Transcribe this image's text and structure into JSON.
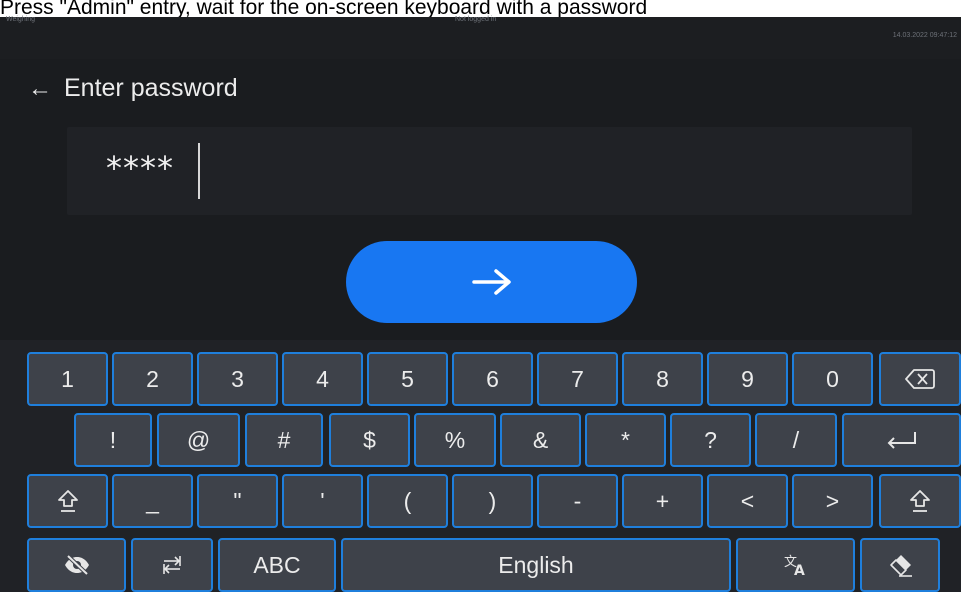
{
  "doc_caption": "Press \"Admin\" entry, wait for the on-screen keyboard with a password",
  "status": {
    "left": "Weighing",
    "center": "Not logged in",
    "right": "14.03.2022 09:47:12"
  },
  "header": {
    "title": "Enter password",
    "back_icon": "←"
  },
  "password": {
    "masked_value": "****"
  },
  "submit": {
    "icon": "arrow-right-icon"
  },
  "keyboard": {
    "row1": [
      "1",
      "2",
      "3",
      "4",
      "5",
      "6",
      "7",
      "8",
      "9",
      "0"
    ],
    "row2": [
      "!",
      "@",
      "#",
      "$",
      "%",
      "&",
      "*",
      "?",
      "/"
    ],
    "row3": [
      "_",
      "\"",
      "'",
      "(",
      ")",
      "-",
      "+",
      "<",
      ">"
    ],
    "row4": {
      "abc": "ABC",
      "language": "English"
    },
    "icons": {
      "backspace": "backspace-icon",
      "enter": "enter-icon",
      "shift_left": "shift-icon",
      "shift_right": "shift-icon",
      "hide": "eye-off-icon",
      "switch": "switch-icon",
      "translate": "translate-icon",
      "clear": "eraser-icon"
    }
  }
}
